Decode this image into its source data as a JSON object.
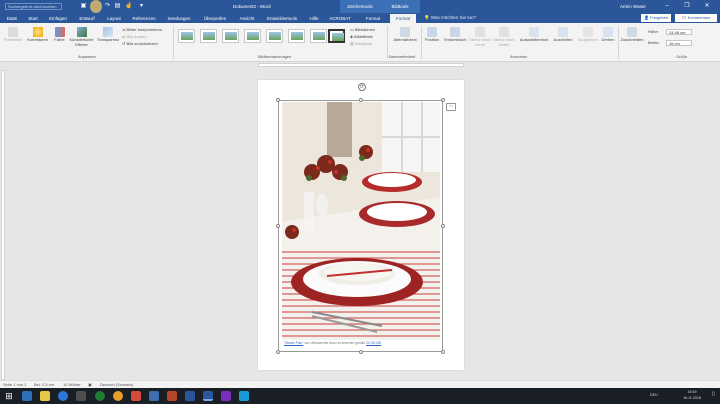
{
  "titlebar": {
    "qat_search_placeholder": "Suchergebnis durchsuchen",
    "document_title": "Dokument2 - Word",
    "context_tab_drawing": "Zeichentools",
    "context_tab_picture": "Bildtools",
    "user": "Armin Waser",
    "minimize": "–",
    "restore": "❐",
    "close": "✕"
  },
  "tabs": [
    "Datei",
    "Start",
    "Einfügen",
    "Entwurf",
    "Layout",
    "Referenzen",
    "Sendungen",
    "Überprüfen",
    "Ansicht",
    "Entwicklertools",
    "Hilfe",
    "ACROBAT",
    "Format",
    "Format"
  ],
  "active_tab_index": 13,
  "search": {
    "label": "Was möchten Sie tun?"
  },
  "share": "Freigeben",
  "comments": "Kommentare",
  "ribbon": {
    "anpassen": {
      "label": "Anpassen",
      "freistellen": "Freistellen",
      "korrekturen": "Korrekturen",
      "farbe": "Farbe",
      "effekte": "Künstlerische Effekte",
      "transparenz": "Transparenz",
      "komprimieren": "Bilder komprimieren",
      "aendern": "Bild ändern",
      "zuruecksetzen": "Bild zurücksetzen"
    },
    "bildformatvorlagen": {
      "label": "Bildformatvorlagen"
    },
    "bild_opts": {
      "rahmen": "Bildrahmen",
      "effekte": "Bildeffekte",
      "layout": "Bildlayout"
    },
    "barrierefreiheit": {
      "label": "Barrierefreiheit",
      "alt": "Alternativtext"
    },
    "anordnen": {
      "label": "Anordnen",
      "position": "Position",
      "textumbruch": "Textumbruch",
      "ebene_vor": "Ebene nach vorne",
      "ebene_zur": "Ebene nach hinten",
      "auswahl": "Auswahlbereich",
      "ausrichten": "Ausrichten",
      "gruppieren": "Gruppieren",
      "drehen": "Drehen"
    },
    "groesse": {
      "label": "Größe",
      "zuschneiden": "Zuschneiden",
      "hoehe_label": "Höhe:",
      "hoehe_value": "24.96 cm",
      "breite_label": "Breite:",
      "breite_value": "15 cm"
    }
  },
  "document": {
    "caption_link1": "\"Dieses Foto\"",
    "caption_mid": " von Unbekannter Autor ist lizenziert gemäß ",
    "caption_link2": "CC BY-ND"
  },
  "statusbar": {
    "page": "Seite 1 von 1",
    "position": "Bei: 2,5 cm",
    "words": "10 Wörter",
    "language": "Deutsch (Schweiz)"
  },
  "taskbar": {
    "lang": "DEU",
    "time": "15:49",
    "date": "16.11.2018"
  }
}
